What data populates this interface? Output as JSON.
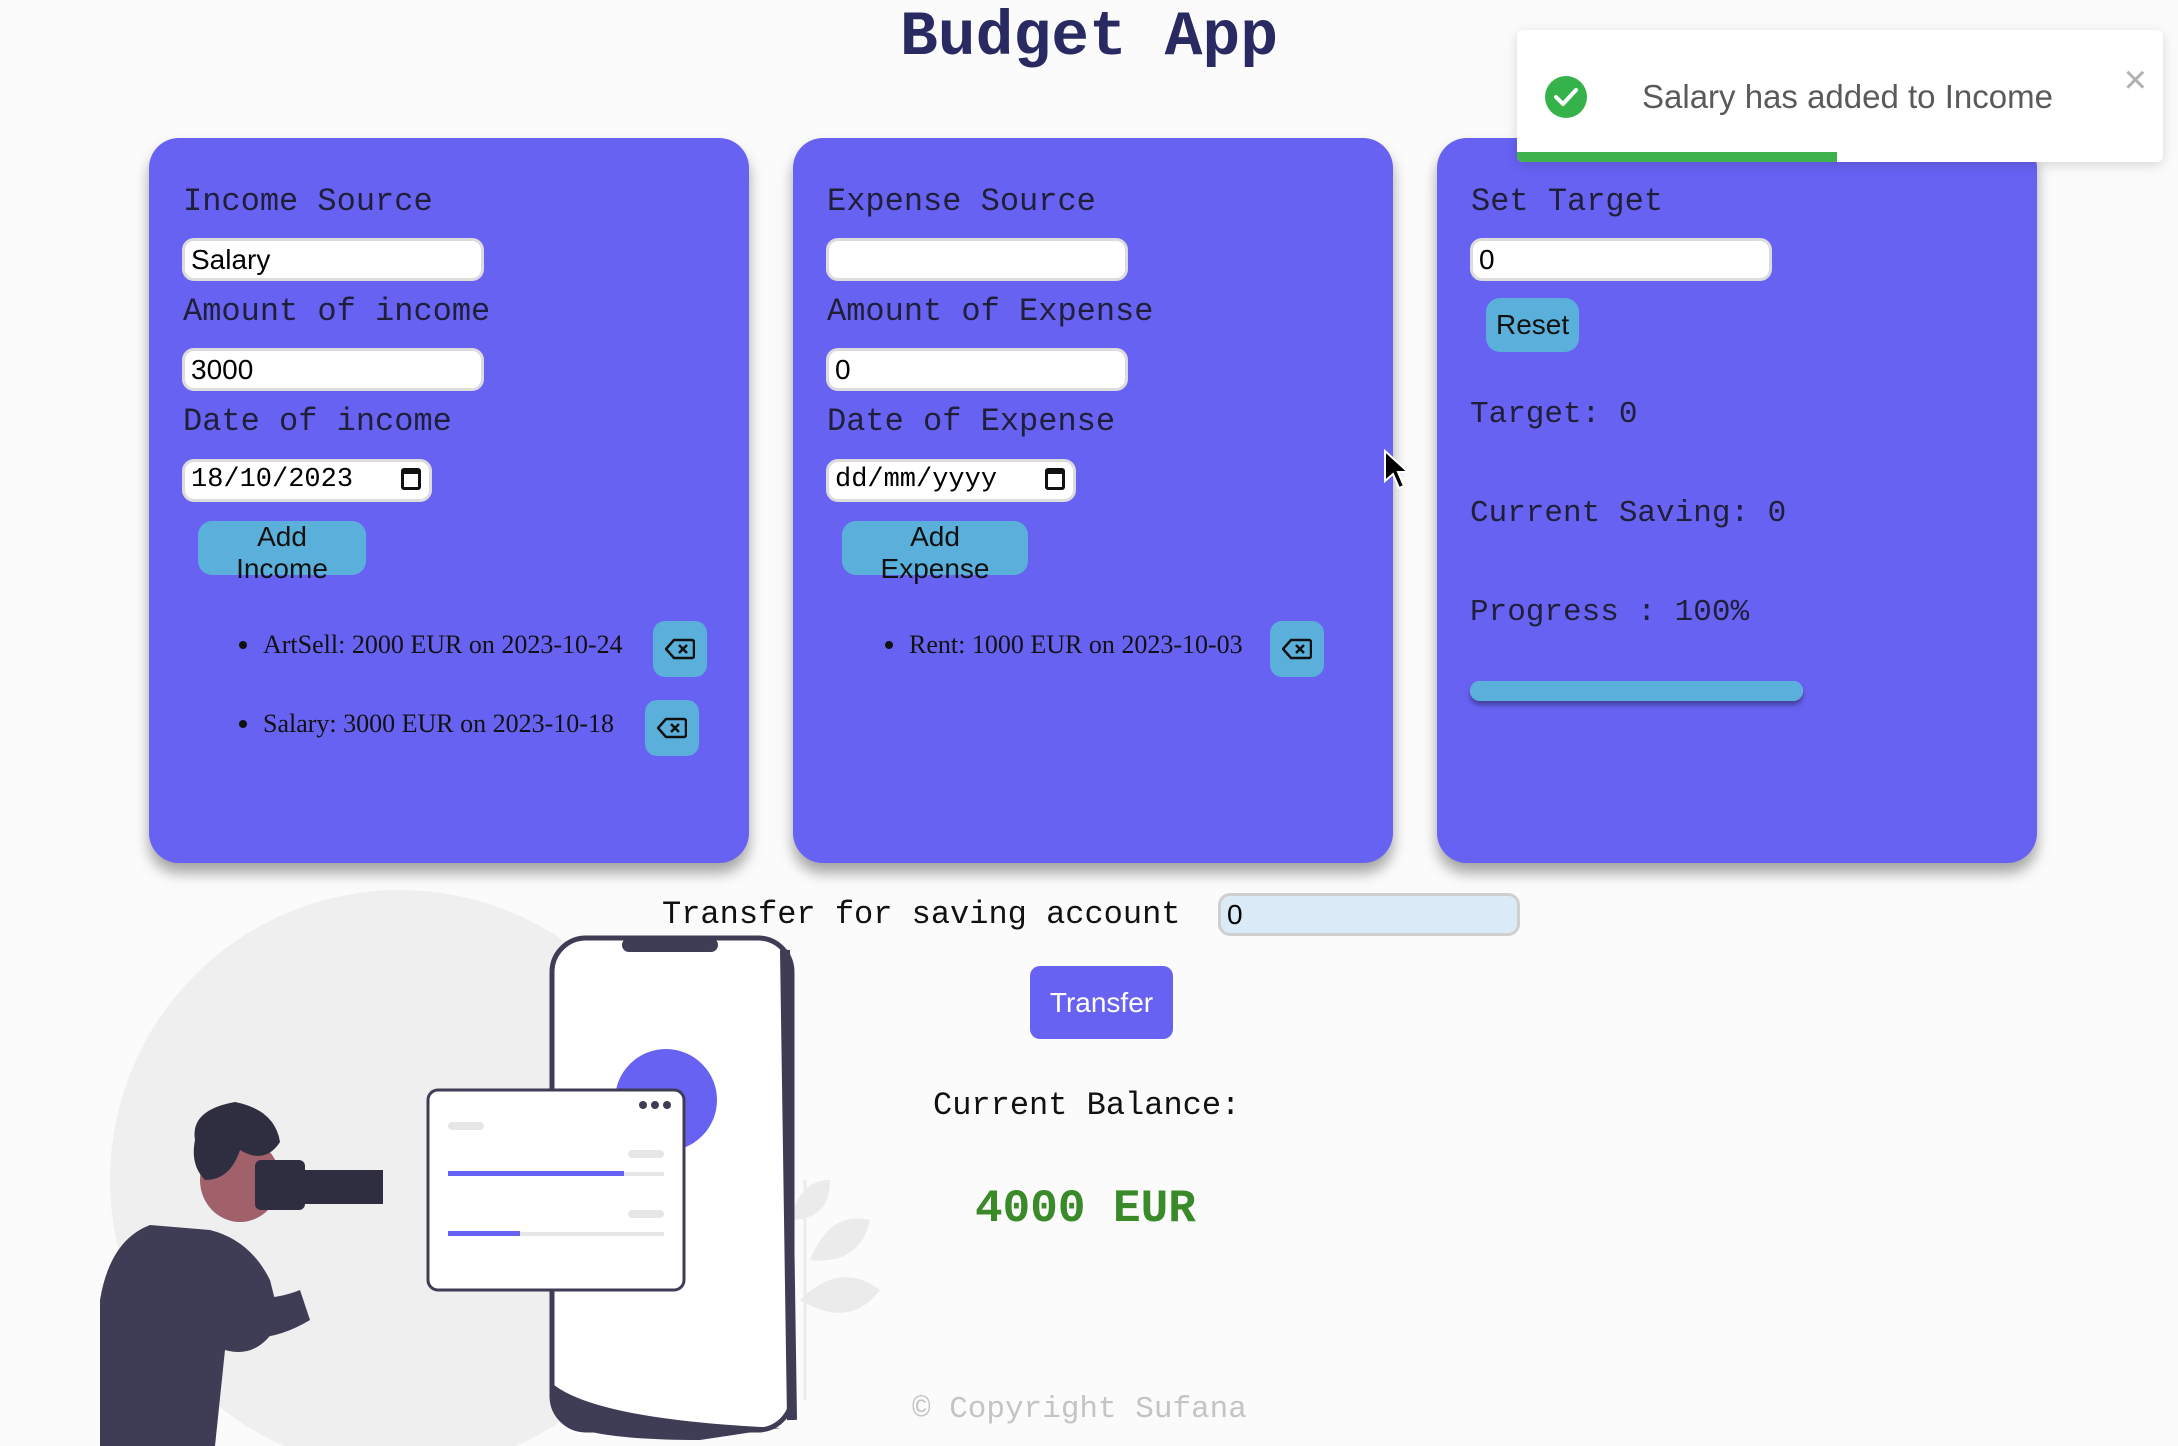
{
  "app": {
    "title": "Budget App"
  },
  "income": {
    "source_label": "Income Source",
    "source_value": "Salary",
    "amount_label": "Amount of income",
    "amount_value": "3000",
    "date_label": "Date of income",
    "date_value": "18/10/2023",
    "add_button": "Add Income",
    "entries": [
      {
        "text": "ArtSell: 2000 EUR on 2023-10-24"
      },
      {
        "text": "Salary: 3000 EUR on 2023-10-18"
      }
    ]
  },
  "expense": {
    "source_label": "Expense Source",
    "source_value": "",
    "amount_label": "Amount of Expense",
    "amount_value": "0",
    "date_label": "Date of Expense",
    "date_value": "dd/mm/yyyy",
    "add_button": "Add Expense",
    "entries": [
      {
        "text": "Rent: 1000 EUR on 2023-10-03"
      }
    ]
  },
  "target": {
    "set_label": "Set Target",
    "target_input": "0",
    "reset_button": "Reset",
    "target_text": "Target: 0",
    "saving_text": "Current Saving: 0",
    "progress_text": "Progress : 100%",
    "progress_value": 1.0
  },
  "toast": {
    "message": "Salary has added to Income",
    "close": "×",
    "progress_remaining": 0.496
  },
  "transfer": {
    "label": "Transfer for saving account",
    "input_value": "0",
    "button": "Transfer"
  },
  "balance": {
    "label": "Current Balance:",
    "value": "4000 EUR"
  },
  "footer": {
    "copyright": "© Copyright Sufana"
  },
  "colors": {
    "card": "#6862f3",
    "button": "#5ab0da",
    "title": "#2a2a62",
    "balance": "#3a8a2a",
    "toast_bar": "#3fb24b"
  },
  "icons": {
    "delete": "backspace-icon",
    "calendar": "calendar-icon",
    "success": "check-circle-icon"
  }
}
